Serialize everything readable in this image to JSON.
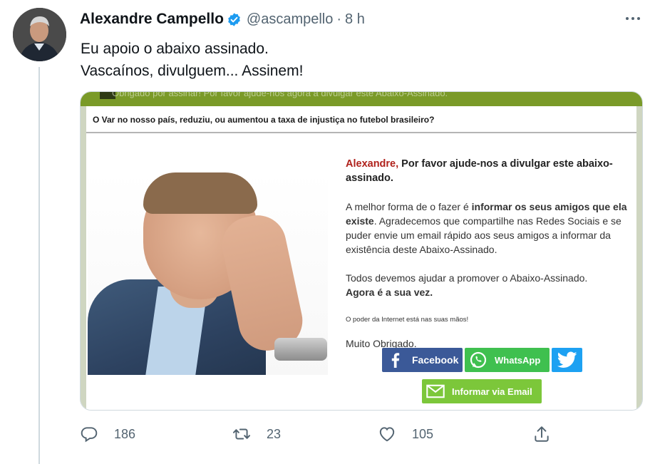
{
  "author": {
    "name": "Alexandre Campello",
    "handle": "@ascampello",
    "separator": "·",
    "time": "8 h"
  },
  "tweet": {
    "lines": [
      "Eu apoio o abaixo assinado.",
      "Vascaínos, divulguem... Assinem!"
    ]
  },
  "card": {
    "top_strip_text": "Obrigado por assinar! Por favor ajude-nos agora a divulgar este Abaixo-Assinado.",
    "question": "O Var no nosso país, reduziu, ou aumentou a taxa de injustiça no futebol brasileiro?",
    "title_name": "Alexandre,",
    "title_rest": " Por favor ajude-nos a divulgar este abaixo-assinado.",
    "p1_a": "A melhor forma de o fazer é ",
    "p1_b": "informar os seus amigos que ela existe",
    "p1_c": ". Agradecemos que compartilhe nas Redes Sociais e se puder envie um email rápido aos seus amigos a informar da existência deste Abaixo-Assinado.",
    "p2_a": "Todos devemos ajudar a promover o Abaixo-Assinado.",
    "p2_b": "Agora é a sua vez.",
    "small": "O poder da Internet está nas suas mãos!",
    "thanks": "Muito Obrigado.",
    "buttons": {
      "facebook": "Facebook",
      "whatsapp": "WhatsApp",
      "email": "Informar via Email"
    }
  },
  "stats": {
    "replies": "186",
    "retweets": "23",
    "likes": "105"
  },
  "colors": {
    "verified": "#1d9bf0",
    "facebook": "#3b5998",
    "whatsapp": "#3fc04f",
    "twitter": "#1da1f2",
    "email": "#7cc73a",
    "header_green": "#7a9a28",
    "name_red": "#b0221c"
  }
}
